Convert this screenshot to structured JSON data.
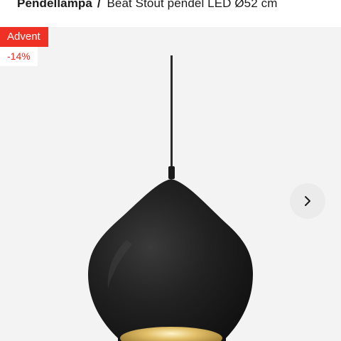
{
  "breadcrumb": {
    "category": "Pendellampa",
    "separator": "/",
    "product": "Beat Stout pendel LED Ø52 cm"
  },
  "badges": {
    "campaign": "Advent",
    "discount": "-14%"
  },
  "gallery": {
    "next_icon": "chevron-right-icon",
    "image_subject": "black pendant lamp with brass interior"
  },
  "colors": {
    "campaign_badge": "#ee3124",
    "discount_text": "#e8291c",
    "gallery_background": "#f3f3f3",
    "lamp_body": "#1c1c1c",
    "lamp_interior": "#c9a24a"
  }
}
